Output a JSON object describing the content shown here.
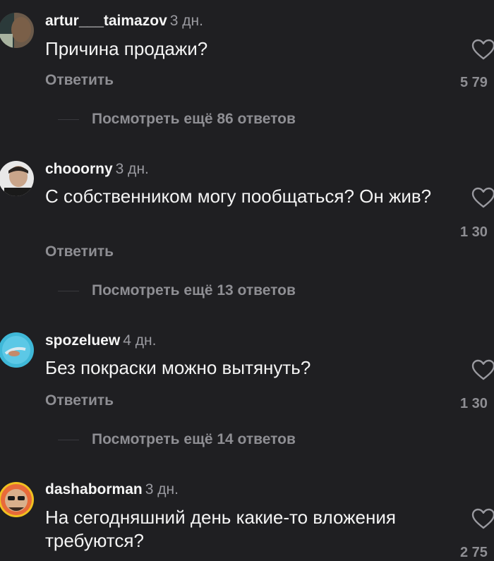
{
  "comments": [
    {
      "username": "artur___taimazov",
      "time": "3 дн.",
      "text": "Причина продажи?",
      "reply_label": "Ответить",
      "likes": "5 79",
      "view_more": "Посмотреть ещё 86 ответов"
    },
    {
      "username": "chooorny",
      "time": "3 дн.",
      "text": "С собственником могу пообщаться? Он жив?",
      "reply_label": "Ответить",
      "likes": "1 30",
      "view_more": "Посмотреть ещё 13 ответов"
    },
    {
      "username": "spozeluew",
      "time": "4 дн.",
      "text": "Без покраски можно вытянуть?",
      "reply_label": "Ответить",
      "likes": "1 30",
      "view_more": "Посмотреть ещё 14 ответов"
    },
    {
      "username": "dashaborman",
      "time": "3 дн.",
      "text": "На сегодняшний день какие-то вложения требуются?",
      "likes": "2 75"
    }
  ],
  "icons": {
    "like": "heart-outline-icon"
  },
  "colors": {
    "background": "#1f1f22",
    "secondary_text": "#8e8e93",
    "primary_text": "#f4f4f4"
  }
}
